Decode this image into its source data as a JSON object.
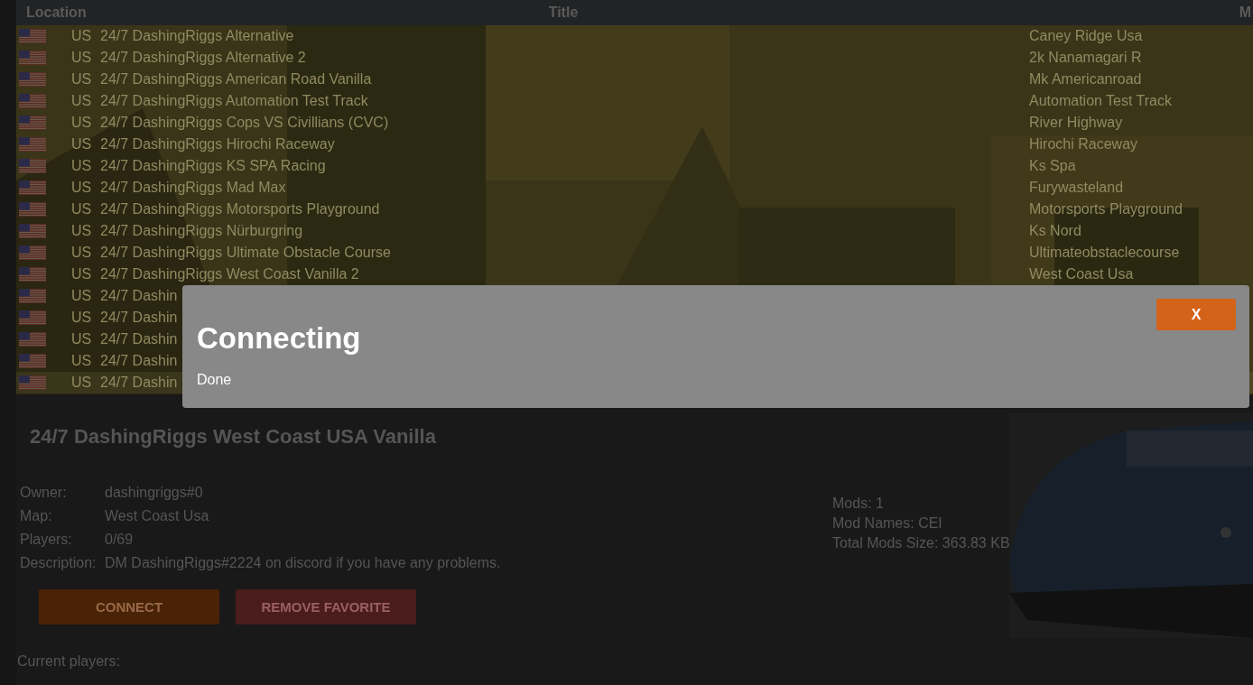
{
  "table": {
    "columns": [
      "Location",
      "Title",
      "M"
    ],
    "rows": [
      {
        "country": "US",
        "title": "24/7 DashingRiggs Alternative",
        "map": "Caney Ridge Usa",
        "selected": false
      },
      {
        "country": "US",
        "title": "24/7 DashingRiggs Alternative 2",
        "map": "2k Nanamagari R",
        "selected": false
      },
      {
        "country": "US",
        "title": "24/7 DashingRiggs American Road Vanilla",
        "map": "Mk Americanroad",
        "selected": false
      },
      {
        "country": "US",
        "title": "24/7 DashingRiggs Automation Test Track",
        "map": "Automation Test Track",
        "selected": false
      },
      {
        "country": "US",
        "title": "24/7 DashingRiggs Cops VS Civillians (CVC)",
        "map": "River Highway",
        "selected": false
      },
      {
        "country": "US",
        "title": "24/7 DashingRiggs Hirochi Raceway",
        "map": "Hirochi Raceway",
        "selected": false
      },
      {
        "country": "US",
        "title": "24/7 DashingRiggs KS SPA Racing",
        "map": "Ks Spa",
        "selected": false
      },
      {
        "country": "US",
        "title": "24/7 DashingRiggs Mad Max",
        "map": "Furywasteland",
        "selected": false
      },
      {
        "country": "US",
        "title": "24/7 DashingRiggs Motorsports Playground",
        "map": "Motorsports Playground",
        "selected": false
      },
      {
        "country": "US",
        "title": "24/7 DashingRiggs Nürburgring",
        "map": "Ks Nord",
        "selected": false
      },
      {
        "country": "US",
        "title": "24/7 DashingRiggs Ultimate Obstacle Course",
        "map": "Ultimateobstaclecourse",
        "selected": false
      },
      {
        "country": "US",
        "title": "24/7 DashingRiggs West Coast Vanilla 2",
        "map": "West Coast Usa",
        "selected": false
      },
      {
        "country": "US",
        "title": "24/7 Dashin",
        "selected": false
      },
      {
        "country": "US",
        "title": "24/7 Dashin",
        "selected": false
      },
      {
        "country": "US",
        "title": "24/7 Dashin",
        "selected": false
      },
      {
        "country": "US",
        "title": "24/7 Dashin",
        "selected": false
      },
      {
        "country": "US",
        "title": "24/7 Dashin",
        "selected": true
      }
    ]
  },
  "details": {
    "title": "24/7 DashingRiggs West Coast USA Vanilla",
    "fields": [
      {
        "label": "Owner:",
        "value": "dashingriggs#0"
      },
      {
        "label": "Map:",
        "value": "West Coast Usa"
      },
      {
        "label": "Players:",
        "value": "0/69"
      },
      {
        "label": "Description:",
        "value": "DM DashingRiggs#2224 on discord if you have any problems."
      }
    ],
    "mods": [
      "Mods: 1",
      "Mod Names: CEI",
      "Total Mods Size: 363.83 KB"
    ],
    "buttons": [
      {
        "label": "CONNECT",
        "kind": "primary"
      },
      {
        "label": "REMOVE FAVORITE",
        "kind": "danger"
      }
    ],
    "players_heading": "Current players:"
  },
  "modal": {
    "title": "Connecting",
    "message": "Done",
    "close_button": "X"
  }
}
